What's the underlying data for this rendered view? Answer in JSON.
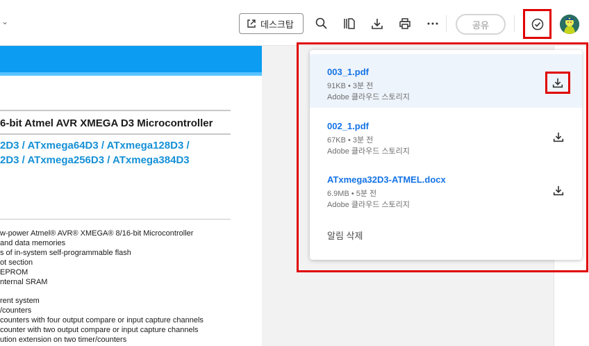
{
  "toolbar": {
    "open_desktop_label": "데스크탑",
    "share_label": "공유",
    "icons": [
      "external-link-icon",
      "search-icon",
      "pages-icon",
      "download-icon",
      "print-icon",
      "more-icon",
      "check-circle-icon"
    ]
  },
  "document": {
    "title": "6-bit Atmel AVR XMEGA D3 Microcontroller",
    "subtitle_1": "2D3 / ATxmega64D3 / ATxmega128D3 /",
    "subtitle_2": "2D3 / ATxmega256D3 / ATxmega384D3",
    "features": [
      "w-power Atmel® AVR® XMEGA® 8/16-bit Microcontroller",
      "and data memories",
      "s of in-system self-programmable flash",
      "ot section",
      "EPROM",
      "nternal SRAM",
      "",
      "rent system",
      "/counters",
      "counters with four output compare or input capture channels",
      "counter with two output compare or input capture channels",
      "ution extension on two timer/counters"
    ],
    "banner_color": "#0c9cf2"
  },
  "notifications": {
    "items": [
      {
        "name": "003_1.pdf",
        "meta": "91KB • 3분 전",
        "location": "Adobe 클라우드 스토리지"
      },
      {
        "name": "002_1.pdf",
        "meta": "67KB • 3분 전",
        "location": "Adobe 클라우드 스토리지"
      },
      {
        "name": "ATxmega32D3-ATMEL.docx",
        "meta": "6.9MB • 5분 전",
        "location": "Adobe 클라우드 스토리지"
      }
    ],
    "clear_label": "알림 삭제"
  },
  "colors": {
    "accent": "#1473e6",
    "highlight": "#e00000"
  }
}
